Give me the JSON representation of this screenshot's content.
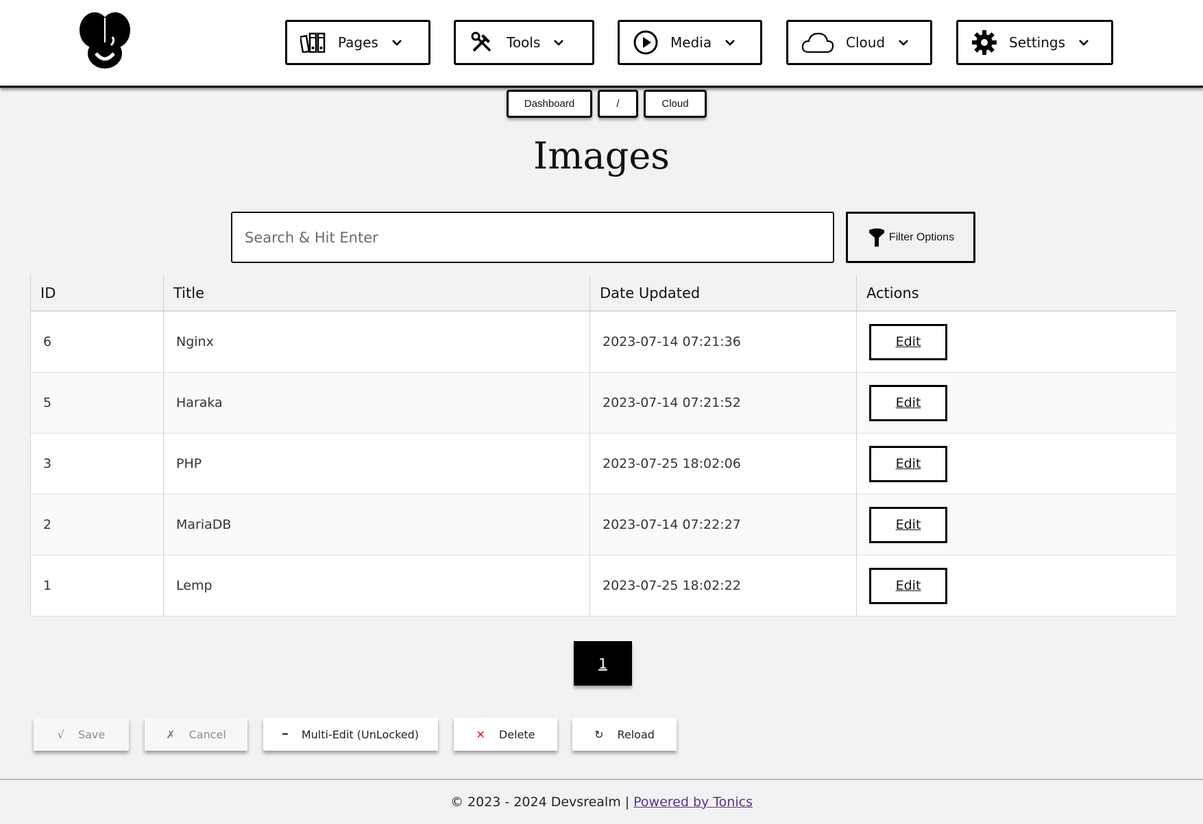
{
  "header": {
    "nav": [
      {
        "label": "Pages",
        "icon": "book-icon"
      },
      {
        "label": "Tools",
        "icon": "tools-icon"
      },
      {
        "label": "Media",
        "icon": "play-icon"
      },
      {
        "label": "Cloud",
        "icon": "cloud-icon"
      },
      {
        "label": "Settings",
        "icon": "gear-icon"
      }
    ]
  },
  "breadcrumb": {
    "items": [
      "Dashboard",
      "/",
      "Cloud"
    ]
  },
  "page": {
    "title": "Images"
  },
  "search": {
    "placeholder": "Search & Hit Enter",
    "value": ""
  },
  "filter": {
    "label": "Filter Options"
  },
  "table": {
    "columns": [
      "ID",
      "Title",
      "Date Updated",
      "Actions"
    ],
    "rows": [
      {
        "id": "6",
        "title": "Nginx",
        "date": "2023-07-14 07:21:36",
        "action": "Edit"
      },
      {
        "id": "5",
        "title": "Haraka",
        "date": "2023-07-14 07:21:52",
        "action": "Edit"
      },
      {
        "id": "3",
        "title": "PHP",
        "date": "2023-07-25 18:02:06",
        "action": "Edit"
      },
      {
        "id": "2",
        "title": "MariaDB",
        "date": "2023-07-14 07:22:27",
        "action": "Edit"
      },
      {
        "id": "1",
        "title": "Lemp",
        "date": "2023-07-25 18:02:22",
        "action": "Edit"
      }
    ]
  },
  "pagination": {
    "current": "1"
  },
  "actions": {
    "save": {
      "glyph": "√",
      "label": "Save"
    },
    "cancel": {
      "glyph": "✗",
      "label": "Cancel"
    },
    "multi_edit": {
      "glyph": "━",
      "label": "Multi-Edit (UnLocked)"
    },
    "delete": {
      "glyph": "✕",
      "label": "Delete"
    },
    "reload": {
      "glyph": "↻",
      "label": "Reload"
    }
  },
  "footer": {
    "copyright": "© 2023 - 2024 Devsrealm |",
    "link": "Powered by Tonics"
  },
  "colors": {
    "background": "#f2f2f4",
    "header_bg": "#ffffff",
    "accent": "#000000",
    "link": "#5a2e8a",
    "delete_glyph": "#d02020",
    "save_glyph": "#4caf50"
  }
}
